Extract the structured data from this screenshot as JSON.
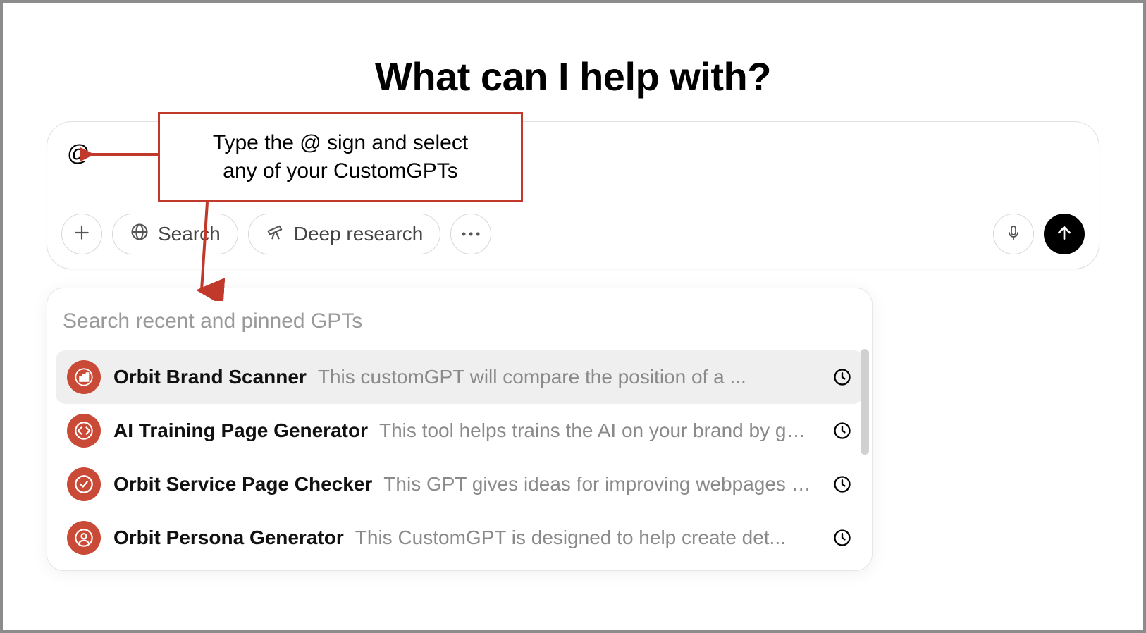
{
  "heading": "What can I help with?",
  "composer": {
    "typed_text": "@",
    "plus_tooltip": "Add",
    "search_label": "Search",
    "deep_research_label": "Deep research",
    "more_tooltip": "More",
    "mic_tooltip": "Voice",
    "send_tooltip": "Send"
  },
  "callout": {
    "text_line1": "Type the @ sign and select",
    "text_line2": "any of your CustomGPTs",
    "border_color": "#c0392b"
  },
  "dropdown": {
    "search_placeholder": "Search recent and pinned GPTs",
    "items": [
      {
        "title": "Orbit Brand Scanner",
        "desc": "This customGPT will compare the position of a ...",
        "icon": "chart",
        "selected": true
      },
      {
        "title": "AI Training Page Generator",
        "desc": "This tool helps trains the AI on your brand by ge...",
        "icon": "code",
        "selected": false
      },
      {
        "title": "Orbit Service Page Checker",
        "desc": "This GPT gives ideas for improving webpages f...",
        "icon": "check",
        "selected": false
      },
      {
        "title": "Orbit Persona Generator",
        "desc": "This CustomGPT is designed to help create det...",
        "icon": "person",
        "selected": false
      }
    ]
  }
}
